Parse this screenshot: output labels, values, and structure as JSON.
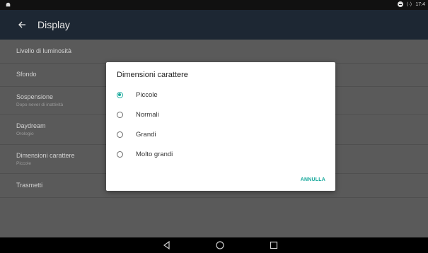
{
  "status_bar": {
    "time": "17:4",
    "cast_icon": "cast-icon",
    "dnd_icon": "do-not-disturb-icon",
    "notification_icon": "android-icon"
  },
  "toolbar": {
    "title": "Display",
    "back_icon": "arrow-back-icon"
  },
  "settings": [
    {
      "title": "Livello di luminosità",
      "subtitle": ""
    },
    {
      "title": "Sfondo",
      "subtitle": ""
    },
    {
      "title": "Sospensione",
      "subtitle": "Dopo never di inattività"
    },
    {
      "title": "Daydream",
      "subtitle": "Orologio"
    },
    {
      "title": "Dimensioni carattere",
      "subtitle": "Piccole"
    },
    {
      "title": "Trasmetti",
      "subtitle": ""
    }
  ],
  "dialog": {
    "title": "Dimensioni carattere",
    "options": [
      {
        "label": "Piccole",
        "selected": true
      },
      {
        "label": "Normali",
        "selected": false
      },
      {
        "label": "Grandi",
        "selected": false
      },
      {
        "label": "Molto grandi",
        "selected": false
      }
    ],
    "cancel_label": "ANNULLA",
    "accent_color": "#18a99c"
  },
  "nav_bar": {
    "back_icon": "nav-back-icon",
    "home_icon": "nav-home-icon",
    "recents_icon": "nav-recents-icon"
  }
}
